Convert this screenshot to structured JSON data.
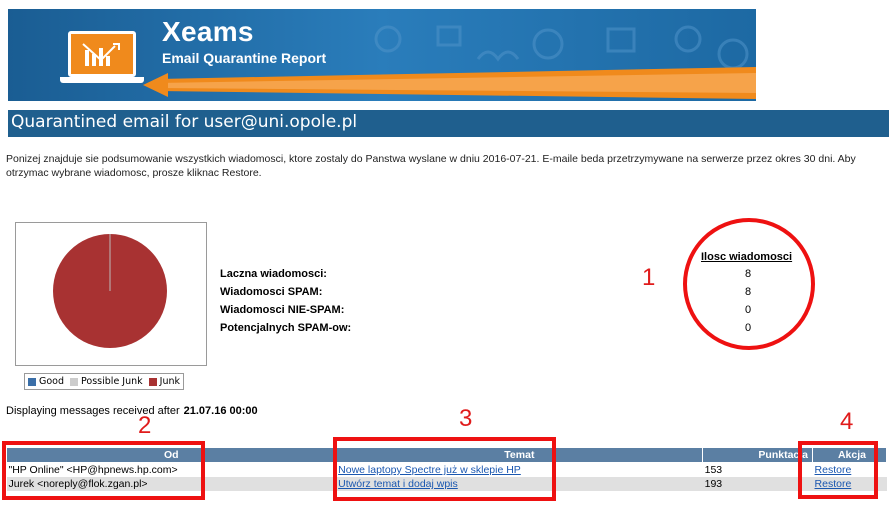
{
  "banner": {
    "brand": "Xeams",
    "tagline": "Email Quarantine Report"
  },
  "title": {
    "prefix": "Quarantined email for ",
    "email": "user@uni.opole.pl"
  },
  "intro": "Ponizej znajduje sie podsumowanie wszystkich wiadomosci, ktore zostaly do Panstwa wyslane w dniu 2016-07-21. E-maile beda przetrzymywane na serwerze przez okres 30 dni. Aby otrzymac wybrane wiadomosc, prosze kliknac Restore.",
  "chart_data": {
    "type": "pie",
    "categories": [
      "Good",
      "Possible Junk",
      "Junk"
    ],
    "values": [
      0,
      0,
      8
    ],
    "colors": [
      "#3b6fa8",
      "#cccccc",
      "#a83232"
    ],
    "legend_position": "bottom"
  },
  "legend": [
    {
      "label": "Good",
      "color": "#3b6fa8"
    },
    {
      "label": "Possible Junk",
      "color": "#cccccc"
    },
    {
      "label": "Junk",
      "color": "#a83232"
    }
  ],
  "stats": {
    "header": "Ilosc wiadomosci",
    "rows": [
      {
        "label": "Laczna wiadomosci:",
        "value": "8"
      },
      {
        "label": "Wiadomosci SPAM:",
        "value": "8"
      },
      {
        "label": "Wiadomosci NIE-SPAM:",
        "value": "0"
      },
      {
        "label": "Potencjalnych SPAM-ow:",
        "value": "0"
      }
    ]
  },
  "annotations": [
    "1",
    "2",
    "3",
    "4"
  ],
  "displaying": {
    "text": "Displaying messages received after",
    "date": "21.07.16 00:00"
  },
  "table": {
    "headers": [
      "Od",
      "Temat",
      "Punktacja",
      "Akcja"
    ],
    "rows": [
      {
        "from": "\"HP Online\" <HP@hpnews.hp.com>",
        "subject": "Nowe laptopy Spectre już w sklepie HP",
        "score": "153",
        "action": "Restore"
      },
      {
        "from": "Jurek <noreply@flok.zgan.pl>",
        "subject": "Utwórz temat i dodaj wpis",
        "score": "193",
        "action": "Restore"
      }
    ]
  },
  "colors": {
    "banner": "#1f6faa",
    "title_bar": "#1f5f8e",
    "table_header": "#5b7fa3",
    "annotation": "#ee1111",
    "accent": "#f08a1c"
  }
}
